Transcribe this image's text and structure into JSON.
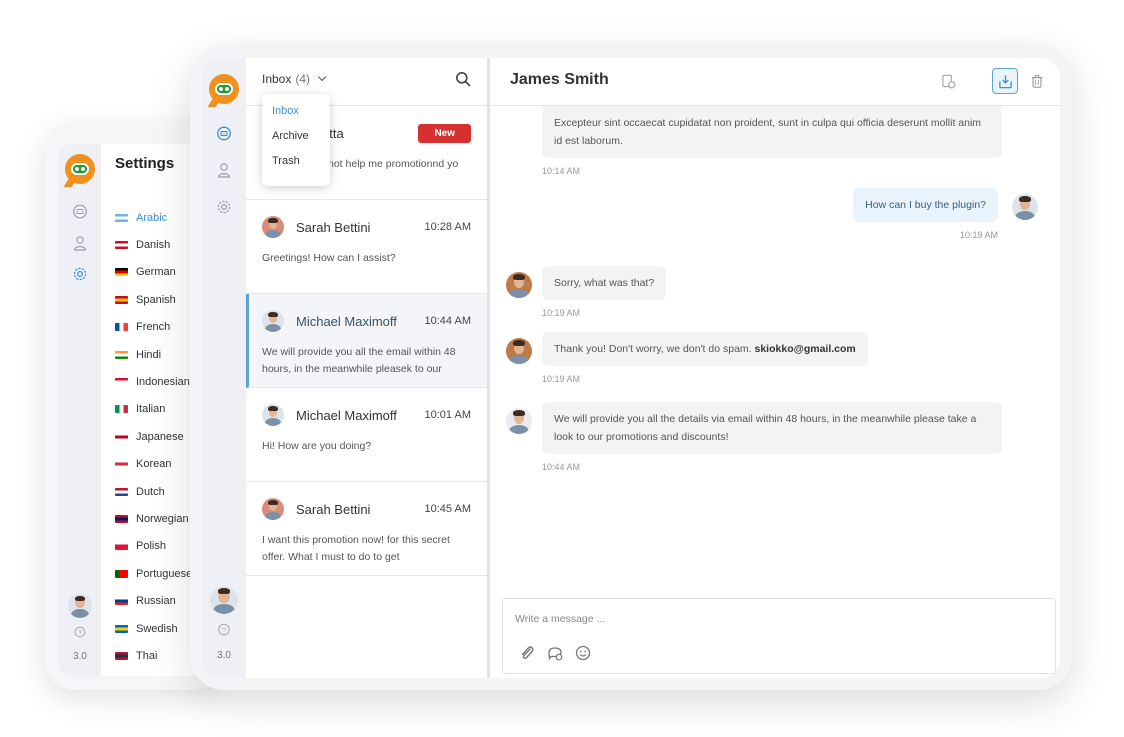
{
  "settings_card": {
    "title": "Settings",
    "languages": [
      {
        "label": "Arabic",
        "active": true,
        "flag": [
          "#6fb3e0",
          "#ffffff",
          "#6fb3e0"
        ]
      },
      {
        "label": "Danish",
        "flag": [
          "#c8102e",
          "#ffffff",
          "#c8102e"
        ]
      },
      {
        "label": "German",
        "flag": [
          "#000000",
          "#dd0000",
          "#ffce00"
        ]
      },
      {
        "label": "Spanish",
        "flag": [
          "#c60b1e",
          "#ffc400",
          "#c60b1e"
        ]
      },
      {
        "label": "French",
        "flag": [
          "#0055a4",
          "#ffffff",
          "#ef4135"
        ],
        "vertical": true
      },
      {
        "label": "Hindi",
        "flag": [
          "#ff9933",
          "#ffffff",
          "#138808"
        ]
      },
      {
        "label": "Indonesian",
        "flag": [
          "#ce1126",
          "#ffffff",
          "#ffffff"
        ]
      },
      {
        "label": "Italian",
        "flag": [
          "#009246",
          "#ffffff",
          "#ce2b37"
        ],
        "vertical": true
      },
      {
        "label": "Japanese",
        "flag": [
          "#ffffff",
          "#bc002d",
          "#ffffff"
        ]
      },
      {
        "label": "Korean",
        "flag": [
          "#ffffff",
          "#cd2e3a",
          "#ffffff"
        ]
      },
      {
        "label": "Dutch",
        "flag": [
          "#ae1c28",
          "#ffffff",
          "#21468b"
        ]
      },
      {
        "label": "Norwegian",
        "flag": [
          "#ba0c2f",
          "#00205b",
          "#ba0c2f"
        ]
      },
      {
        "label": "Polish",
        "flag": [
          "#ffffff",
          "#dc143c",
          "#dc143c"
        ]
      },
      {
        "label": "Portuguese",
        "flag": [
          "#006600",
          "#ff0000",
          "#ff0000"
        ],
        "vertical": true
      },
      {
        "label": "Russian",
        "flag": [
          "#ffffff",
          "#0039a6",
          "#d52b1e"
        ]
      },
      {
        "label": "Swedish",
        "flag": [
          "#006aa7",
          "#fecc00",
          "#006aa7"
        ]
      },
      {
        "label": "Thai",
        "flag": [
          "#a51931",
          "#2d2a4a",
          "#a51931"
        ]
      }
    ],
    "version": "3.0"
  },
  "sidebar": {
    "items": [
      {
        "name": "conversations",
        "icon": "chat-bubble-icon"
      },
      {
        "name": "users",
        "icon": "user-icon"
      },
      {
        "name": "settings",
        "icon": "gear-icon"
      }
    ],
    "version": "3.0",
    "help_icon": "help-circle-icon"
  },
  "inbox": {
    "folder_label": "Inbox",
    "count": "(4)",
    "dropdown_options": [
      {
        "label": "Inbox",
        "active": true
      },
      {
        "label": "Archive"
      },
      {
        "label": "Trash"
      }
    ],
    "conversations": [
      {
        "name": "Larissa Satta",
        "visible_name": "sa Satta",
        "time": "",
        "badge": "New",
        "preview": "Can you not help me promotionnd yo",
        "visible_preview": "not help me promotionnd yo"
      },
      {
        "name": "Sarah Bettini",
        "time": "10:28 AM",
        "preview": "Greetings! How can I assist?"
      },
      {
        "name": "Michael Maximoff",
        "time": "10:44 AM",
        "preview": "We will provide you all the  email within 48 hours, in the meanwhile pleasek to our",
        "active": true
      },
      {
        "name": "Michael Maximoff",
        "time": "10:01 AM",
        "preview": "Hi! How are you doing?"
      },
      {
        "name": "Sarah Bettini",
        "time": "10:45 AM",
        "preview": "I want this promotion now! for this secret offer. What I must to do to get"
      }
    ]
  },
  "chat": {
    "title": "James Smith",
    "header_actions": [
      "transfer-icon",
      "archive-icon",
      "trash-icon"
    ],
    "messages": [
      {
        "direction": "in",
        "text": "Excepteur sint occaecat cupidatat non proident, sunt in culpa qui officia deserunt mollit anim id est laborum.",
        "time": "10:14 AM",
        "avatar": false
      },
      {
        "direction": "out",
        "text": "How can I buy the plugin?",
        "time": "10:19 AM"
      },
      {
        "direction": "in",
        "text": "Sorry, what was that?",
        "time": "10:19 AM"
      },
      {
        "direction": "in",
        "text": "Thank you! Don't worry, we don't do spam.",
        "bold": "skiokko@gmail.com",
        "time": "10:19 AM"
      },
      {
        "direction": "in",
        "text": "We will provide you all the details via email within 48 hours, in the meanwhile please take a look to our promotions and discounts!",
        "time": "10:44 AM"
      }
    ],
    "composer": {
      "placeholder": "Write a message ...",
      "value": "",
      "tools": [
        "paperclip-icon",
        "saved-replies-icon",
        "emoji-icon"
      ]
    }
  },
  "colors": {
    "accent": "#3a8fd3",
    "brand_orange": "#f0911d",
    "brand_green": "#1f9a3a",
    "badge_red": "#d63031"
  }
}
